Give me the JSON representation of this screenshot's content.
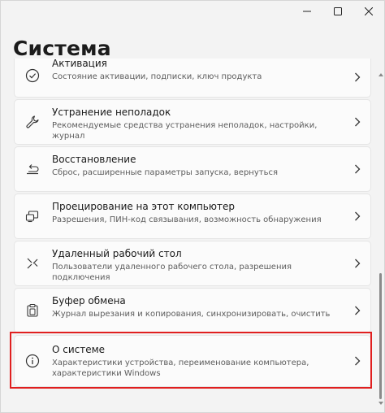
{
  "window": {
    "title": "Система",
    "controls": [
      {
        "name": "minimize-button",
        "icon": "minimize-icon"
      },
      {
        "name": "maximize-button",
        "icon": "maximize-icon"
      },
      {
        "name": "close-button",
        "icon": "close-icon"
      }
    ]
  },
  "items": [
    {
      "title": "Активация",
      "subtitle": "Состояние активации, подписки, ключ продукта",
      "icon": "check-circle-icon"
    },
    {
      "title": "Устранение неполадок",
      "subtitle": "Рекомендуемые средства устранения неполадок, настройки, журнал",
      "icon": "wrench-icon"
    },
    {
      "title": "Восстановление",
      "subtitle": "Сброс, расширенные параметры запуска, вернуться",
      "icon": "recovery-icon"
    },
    {
      "title": "Проецирование на этот компьютер",
      "subtitle": "Разрешения, ПИН-код связывания, возможность обнаружения",
      "icon": "projection-icon"
    },
    {
      "title": "Удаленный рабочий стол",
      "subtitle": "Пользователи удаленного рабочего стола, разрешения подключения",
      "icon": "remote-desktop-icon"
    },
    {
      "title": "Буфер обмена",
      "subtitle": "Журнал вырезания и копирования, синхронизировать, очистить",
      "icon": "clipboard-icon"
    },
    {
      "title": "О системе",
      "subtitle": "Характеристики устройства, переименование компьютера, характеристики Windows",
      "icon": "info-icon",
      "highlighted": true
    }
  ],
  "colors": {
    "highlight_border": "#e01f1f",
    "card_background": "#fbfbfb",
    "window_background": "#f3f3f3"
  }
}
